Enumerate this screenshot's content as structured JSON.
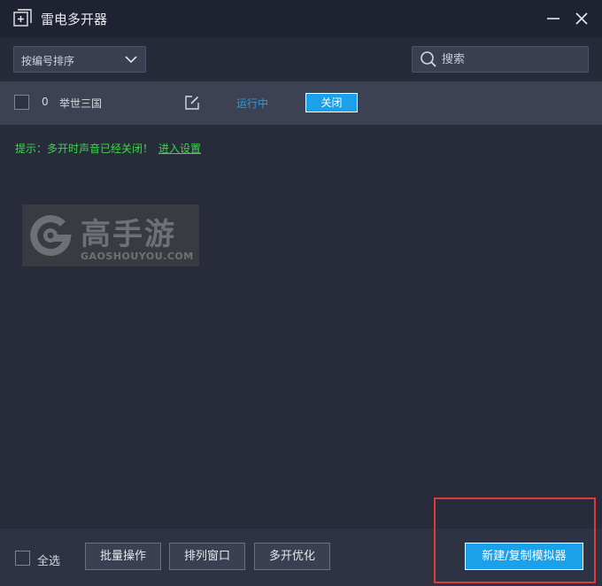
{
  "window": {
    "title": "雷电多开器"
  },
  "toolbar": {
    "sort": {
      "selected": "按编号排序"
    },
    "search": {
      "placeholder": "搜索",
      "value": ""
    }
  },
  "emulators": [
    {
      "index": "0",
      "name": "举世三国",
      "status": "运行中",
      "action_label": "关闭"
    }
  ],
  "hint": {
    "text": "提示：多开时声音已经关闭！",
    "link": "进入设置"
  },
  "watermark": {
    "title": "高手游",
    "subtitle": "GAOSHOUYOU.COM"
  },
  "footer": {
    "select_all": "全选",
    "batch_label": "批量操作",
    "arrange_label": "排列窗口",
    "optimize_label": "多开优化",
    "new_label": "新建/复制模拟器"
  },
  "colors": {
    "accent": "#1aa1ea",
    "status_running": "#19a3e6",
    "hint_green": "#3dd64a",
    "highlight_red": "#e0393b"
  }
}
